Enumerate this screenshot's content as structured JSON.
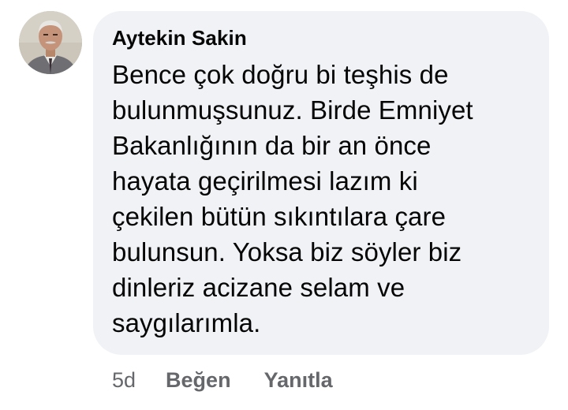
{
  "comment": {
    "avatar_icon": "profile-photo",
    "author": "Aytekin Sakin",
    "text": "Bence çok doğru bi teşhis de\nbulunmuşsunuz. Birde Emniyet\nBakanlığının da bir an önce\nhayata geçirilmesi lazım ki\nçekilen bütün sıkıntılara çare\nbulunsun. Yoksa biz söyler biz\ndinleriz acizane selam ve\nsaygılarımla.",
    "timestamp": "5d",
    "like_label": "Beğen",
    "reply_label": "Yanıtla"
  },
  "colors": {
    "bubble_bg": "#f0f2f5",
    "text": "#050505",
    "meta": "#65676b"
  }
}
